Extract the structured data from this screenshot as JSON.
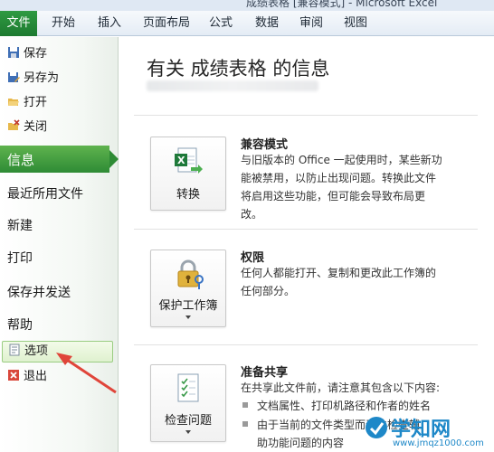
{
  "window": {
    "title": "成绩表格 [兼容模式] - Microsoft Excel"
  },
  "ribbon": {
    "tabs": [
      {
        "label": "文件",
        "active": true
      },
      {
        "label": "开始"
      },
      {
        "label": "插入"
      },
      {
        "label": "页面布局"
      },
      {
        "label": "公式"
      },
      {
        "label": "数据"
      },
      {
        "label": "审阅"
      },
      {
        "label": "视图"
      }
    ]
  },
  "sidebar": {
    "commands": [
      {
        "label": "保存",
        "icon": "save-icon"
      },
      {
        "label": "另存为",
        "icon": "save-as-icon"
      },
      {
        "label": "打开",
        "icon": "open-folder-icon"
      },
      {
        "label": "关闭",
        "icon": "close-file-icon"
      }
    ],
    "nav": [
      {
        "label": "信息",
        "active": true
      },
      {
        "label": "最近所用文件"
      },
      {
        "label": "新建"
      },
      {
        "label": "打印"
      },
      {
        "label": "保存并发送"
      },
      {
        "label": "帮助"
      }
    ],
    "bottom": [
      {
        "label": "选项",
        "icon": "options-icon",
        "highlighted": true
      },
      {
        "label": "退出",
        "icon": "exit-icon"
      }
    ]
  },
  "info": {
    "title": "有关 成绩表格 的信息",
    "sections": [
      {
        "button": "转换",
        "icon": "convert-excel-icon",
        "title": "兼容模式",
        "lines": [
          "与旧版本的 Office 一起使用时，某些新功",
          "能被禁用，以防止出现问题。转换此文件",
          "将启用这些功能，但可能会导致布局更",
          "改。"
        ]
      },
      {
        "button": "保护工作簿",
        "icon": "lock-key-icon",
        "title": "权限",
        "lines": [
          "任何人都能打开、复制和更改此工作簿的",
          "任何部分。"
        ]
      },
      {
        "button": "检查问题",
        "icon": "check-document-icon",
        "title": "准备共享",
        "lines": [
          "在共享此文件前，请注意其包含以下内容:"
        ],
        "bullets": [
          "文档属性、打印机路径和作者的姓名",
          "由于当前的文件类型而无法检查辅",
          "助功能问题的内容"
        ]
      }
    ]
  },
  "watermark": {
    "text": "学知网",
    "url": "www.jmqz1000.com"
  },
  "colors": {
    "file_tab": "#1d7a30",
    "active_nav": "#2e8b35",
    "annotation_arrow": "#e0453a",
    "watermark": "#1e88c8"
  }
}
